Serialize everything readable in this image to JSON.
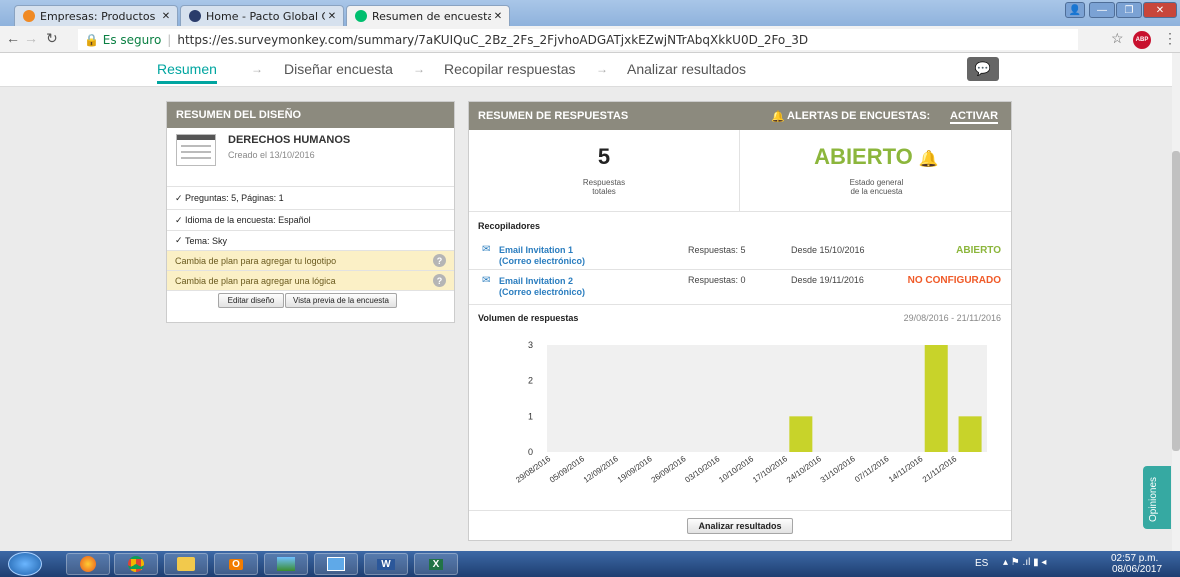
{
  "browser": {
    "tabs": [
      {
        "title": "Empresas: Productos y S"
      },
      {
        "title": "Home - Pacto Global Col"
      },
      {
        "title": "Resumen de encuestas d"
      }
    ],
    "secure_label": "Es seguro",
    "url": "https://es.surveymonkey.com/summary/7aKUIQuC_2Bz_2Fs_2FjvhoADGATjxkEZwjNTrAbqXkkU0D_2Fo_3D"
  },
  "nav": {
    "items": [
      "Resumen",
      "Diseñar encuesta",
      "Recopilar respuestas",
      "Analizar resultados"
    ],
    "feedback_tab": "Opiniones"
  },
  "design_summary": {
    "header": "RESUMEN DEL DISEÑO",
    "survey_title": "DERECHOS HUMANOS",
    "created": "Creado el 13/10/2016",
    "questions_pages": "Preguntas: 5, Páginas: 1",
    "language": "Idioma de la encuesta: Español",
    "theme": "Tema: Sky",
    "upgrade_logo": "Cambia de plan para agregar tu logotipo",
    "upgrade_logic": "Cambia de plan para agregar una lógica",
    "edit_button": "Editar diseño",
    "preview_button": "Vista previa de la encuesta"
  },
  "response_summary": {
    "header": "RESUMEN DE RESPUESTAS",
    "alerts_label": "ALERTAS DE ENCUESTAS:",
    "alerts_action": "ACTIVAR",
    "total": "5",
    "total_label_1": "Respuestas",
    "total_label_2": "totales",
    "status": "ABIERTO",
    "status_label_1": "Estado general",
    "status_label_2": "de la encuesta",
    "collectors_title": "Recopiladores",
    "collectors": [
      {
        "name": "Email Invitation 1",
        "type": "(Correo electrónico)",
        "responses": "Respuestas: 5",
        "since": "Desde 15/10/2016",
        "status": "ABIERTO",
        "status_color": "#8cb63c"
      },
      {
        "name": "Email Invitation 2",
        "type": "(Correo electrónico)",
        "responses": "Respuestas: 0",
        "since": "Desde 19/11/2016",
        "status": "NO CONFIGURADO",
        "status_color": "#f05a28"
      }
    ],
    "volume_title": "Volumen de respuestas",
    "volume_range": "29/08/2016 - 21/11/2016",
    "analyze_button": "Analizar resultados"
  },
  "chart_data": {
    "type": "bar",
    "categories": [
      "29/08/2016",
      "05/09/2016",
      "12/09/2016",
      "19/09/2016",
      "26/09/2016",
      "03/10/2016",
      "10/10/2016",
      "17/10/2016",
      "24/10/2016",
      "31/10/2016",
      "07/11/2016",
      "14/11/2016",
      "21/11/2016"
    ],
    "values": [
      0,
      0,
      0,
      0,
      0,
      0,
      0,
      1,
      0,
      0,
      0,
      3,
      1
    ],
    "yticks": [
      "0",
      "1",
      "2",
      "3"
    ],
    "ylim": [
      0,
      3
    ],
    "bar_color": "#c8d32a",
    "grid": false
  },
  "taskbar": {
    "lang": "ES",
    "time": "02:57 p.m.",
    "date": "08/06/2017"
  },
  "colors": {
    "accent": "#00a5a0",
    "header": "#8c8a7e",
    "green": "#8cb63c",
    "orange": "#f05a28"
  }
}
